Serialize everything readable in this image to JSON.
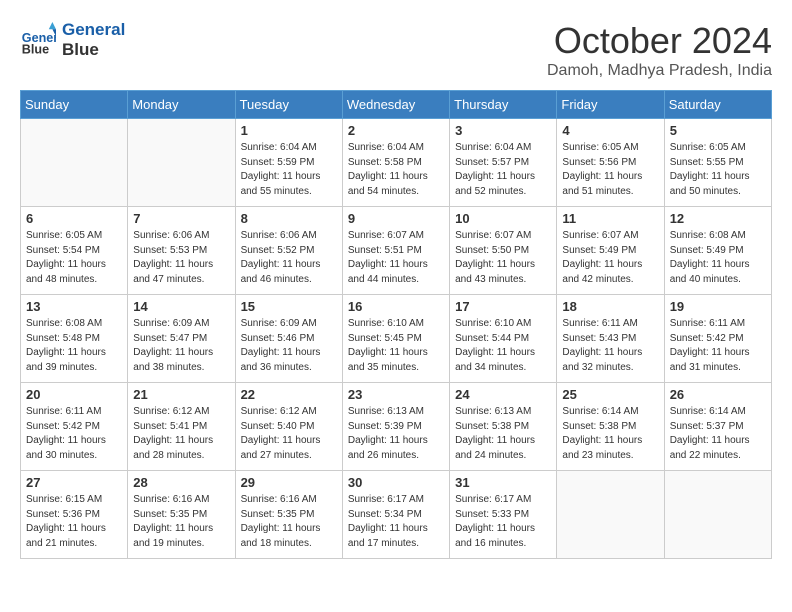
{
  "logo": {
    "line1": "General",
    "line2": "Blue"
  },
  "title": "October 2024",
  "subtitle": "Damoh, Madhya Pradesh, India",
  "days_header": [
    "Sunday",
    "Monday",
    "Tuesday",
    "Wednesday",
    "Thursday",
    "Friday",
    "Saturday"
  ],
  "weeks": [
    [
      {
        "day": "",
        "info": ""
      },
      {
        "day": "",
        "info": ""
      },
      {
        "day": "1",
        "info": "Sunrise: 6:04 AM\nSunset: 5:59 PM\nDaylight: 11 hours and 55 minutes."
      },
      {
        "day": "2",
        "info": "Sunrise: 6:04 AM\nSunset: 5:58 PM\nDaylight: 11 hours and 54 minutes."
      },
      {
        "day": "3",
        "info": "Sunrise: 6:04 AM\nSunset: 5:57 PM\nDaylight: 11 hours and 52 minutes."
      },
      {
        "day": "4",
        "info": "Sunrise: 6:05 AM\nSunset: 5:56 PM\nDaylight: 11 hours and 51 minutes."
      },
      {
        "day": "5",
        "info": "Sunrise: 6:05 AM\nSunset: 5:55 PM\nDaylight: 11 hours and 50 minutes."
      }
    ],
    [
      {
        "day": "6",
        "info": "Sunrise: 6:05 AM\nSunset: 5:54 PM\nDaylight: 11 hours and 48 minutes."
      },
      {
        "day": "7",
        "info": "Sunrise: 6:06 AM\nSunset: 5:53 PM\nDaylight: 11 hours and 47 minutes."
      },
      {
        "day": "8",
        "info": "Sunrise: 6:06 AM\nSunset: 5:52 PM\nDaylight: 11 hours and 46 minutes."
      },
      {
        "day": "9",
        "info": "Sunrise: 6:07 AM\nSunset: 5:51 PM\nDaylight: 11 hours and 44 minutes."
      },
      {
        "day": "10",
        "info": "Sunrise: 6:07 AM\nSunset: 5:50 PM\nDaylight: 11 hours and 43 minutes."
      },
      {
        "day": "11",
        "info": "Sunrise: 6:07 AM\nSunset: 5:49 PM\nDaylight: 11 hours and 42 minutes."
      },
      {
        "day": "12",
        "info": "Sunrise: 6:08 AM\nSunset: 5:49 PM\nDaylight: 11 hours and 40 minutes."
      }
    ],
    [
      {
        "day": "13",
        "info": "Sunrise: 6:08 AM\nSunset: 5:48 PM\nDaylight: 11 hours and 39 minutes."
      },
      {
        "day": "14",
        "info": "Sunrise: 6:09 AM\nSunset: 5:47 PM\nDaylight: 11 hours and 38 minutes."
      },
      {
        "day": "15",
        "info": "Sunrise: 6:09 AM\nSunset: 5:46 PM\nDaylight: 11 hours and 36 minutes."
      },
      {
        "day": "16",
        "info": "Sunrise: 6:10 AM\nSunset: 5:45 PM\nDaylight: 11 hours and 35 minutes."
      },
      {
        "day": "17",
        "info": "Sunrise: 6:10 AM\nSunset: 5:44 PM\nDaylight: 11 hours and 34 minutes."
      },
      {
        "day": "18",
        "info": "Sunrise: 6:11 AM\nSunset: 5:43 PM\nDaylight: 11 hours and 32 minutes."
      },
      {
        "day": "19",
        "info": "Sunrise: 6:11 AM\nSunset: 5:42 PM\nDaylight: 11 hours and 31 minutes."
      }
    ],
    [
      {
        "day": "20",
        "info": "Sunrise: 6:11 AM\nSunset: 5:42 PM\nDaylight: 11 hours and 30 minutes."
      },
      {
        "day": "21",
        "info": "Sunrise: 6:12 AM\nSunset: 5:41 PM\nDaylight: 11 hours and 28 minutes."
      },
      {
        "day": "22",
        "info": "Sunrise: 6:12 AM\nSunset: 5:40 PM\nDaylight: 11 hours and 27 minutes."
      },
      {
        "day": "23",
        "info": "Sunrise: 6:13 AM\nSunset: 5:39 PM\nDaylight: 11 hours and 26 minutes."
      },
      {
        "day": "24",
        "info": "Sunrise: 6:13 AM\nSunset: 5:38 PM\nDaylight: 11 hours and 24 minutes."
      },
      {
        "day": "25",
        "info": "Sunrise: 6:14 AM\nSunset: 5:38 PM\nDaylight: 11 hours and 23 minutes."
      },
      {
        "day": "26",
        "info": "Sunrise: 6:14 AM\nSunset: 5:37 PM\nDaylight: 11 hours and 22 minutes."
      }
    ],
    [
      {
        "day": "27",
        "info": "Sunrise: 6:15 AM\nSunset: 5:36 PM\nDaylight: 11 hours and 21 minutes."
      },
      {
        "day": "28",
        "info": "Sunrise: 6:16 AM\nSunset: 5:35 PM\nDaylight: 11 hours and 19 minutes."
      },
      {
        "day": "29",
        "info": "Sunrise: 6:16 AM\nSunset: 5:35 PM\nDaylight: 11 hours and 18 minutes."
      },
      {
        "day": "30",
        "info": "Sunrise: 6:17 AM\nSunset: 5:34 PM\nDaylight: 11 hours and 17 minutes."
      },
      {
        "day": "31",
        "info": "Sunrise: 6:17 AM\nSunset: 5:33 PM\nDaylight: 11 hours and 16 minutes."
      },
      {
        "day": "",
        "info": ""
      },
      {
        "day": "",
        "info": ""
      }
    ]
  ]
}
